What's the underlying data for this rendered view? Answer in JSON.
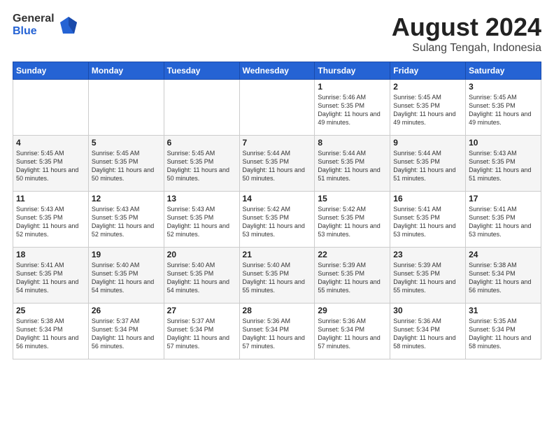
{
  "logo": {
    "general": "General",
    "blue": "Blue"
  },
  "title": {
    "month_year": "August 2024",
    "location": "Sulang Tengah, Indonesia"
  },
  "headers": [
    "Sunday",
    "Monday",
    "Tuesday",
    "Wednesday",
    "Thursday",
    "Friday",
    "Saturday"
  ],
  "weeks": [
    [
      {
        "day": "",
        "sunrise": "",
        "sunset": "",
        "daylight": ""
      },
      {
        "day": "",
        "sunrise": "",
        "sunset": "",
        "daylight": ""
      },
      {
        "day": "",
        "sunrise": "",
        "sunset": "",
        "daylight": ""
      },
      {
        "day": "",
        "sunrise": "",
        "sunset": "",
        "daylight": ""
      },
      {
        "day": "1",
        "sunrise": "Sunrise: 5:46 AM",
        "sunset": "Sunset: 5:35 PM",
        "daylight": "Daylight: 11 hours and 49 minutes."
      },
      {
        "day": "2",
        "sunrise": "Sunrise: 5:45 AM",
        "sunset": "Sunset: 5:35 PM",
        "daylight": "Daylight: 11 hours and 49 minutes."
      },
      {
        "day": "3",
        "sunrise": "Sunrise: 5:45 AM",
        "sunset": "Sunset: 5:35 PM",
        "daylight": "Daylight: 11 hours and 49 minutes."
      }
    ],
    [
      {
        "day": "4",
        "sunrise": "Sunrise: 5:45 AM",
        "sunset": "Sunset: 5:35 PM",
        "daylight": "Daylight: 11 hours and 50 minutes."
      },
      {
        "day": "5",
        "sunrise": "Sunrise: 5:45 AM",
        "sunset": "Sunset: 5:35 PM",
        "daylight": "Daylight: 11 hours and 50 minutes."
      },
      {
        "day": "6",
        "sunrise": "Sunrise: 5:45 AM",
        "sunset": "Sunset: 5:35 PM",
        "daylight": "Daylight: 11 hours and 50 minutes."
      },
      {
        "day": "7",
        "sunrise": "Sunrise: 5:44 AM",
        "sunset": "Sunset: 5:35 PM",
        "daylight": "Daylight: 11 hours and 50 minutes."
      },
      {
        "day": "8",
        "sunrise": "Sunrise: 5:44 AM",
        "sunset": "Sunset: 5:35 PM",
        "daylight": "Daylight: 11 hours and 51 minutes."
      },
      {
        "day": "9",
        "sunrise": "Sunrise: 5:44 AM",
        "sunset": "Sunset: 5:35 PM",
        "daylight": "Daylight: 11 hours and 51 minutes."
      },
      {
        "day": "10",
        "sunrise": "Sunrise: 5:43 AM",
        "sunset": "Sunset: 5:35 PM",
        "daylight": "Daylight: 11 hours and 51 minutes."
      }
    ],
    [
      {
        "day": "11",
        "sunrise": "Sunrise: 5:43 AM",
        "sunset": "Sunset: 5:35 PM",
        "daylight": "Daylight: 11 hours and 52 minutes."
      },
      {
        "day": "12",
        "sunrise": "Sunrise: 5:43 AM",
        "sunset": "Sunset: 5:35 PM",
        "daylight": "Daylight: 11 hours and 52 minutes."
      },
      {
        "day": "13",
        "sunrise": "Sunrise: 5:43 AM",
        "sunset": "Sunset: 5:35 PM",
        "daylight": "Daylight: 11 hours and 52 minutes."
      },
      {
        "day": "14",
        "sunrise": "Sunrise: 5:42 AM",
        "sunset": "Sunset: 5:35 PM",
        "daylight": "Daylight: 11 hours and 53 minutes."
      },
      {
        "day": "15",
        "sunrise": "Sunrise: 5:42 AM",
        "sunset": "Sunset: 5:35 PM",
        "daylight": "Daylight: 11 hours and 53 minutes."
      },
      {
        "day": "16",
        "sunrise": "Sunrise: 5:41 AM",
        "sunset": "Sunset: 5:35 PM",
        "daylight": "Daylight: 11 hours and 53 minutes."
      },
      {
        "day": "17",
        "sunrise": "Sunrise: 5:41 AM",
        "sunset": "Sunset: 5:35 PM",
        "daylight": "Daylight: 11 hours and 53 minutes."
      }
    ],
    [
      {
        "day": "18",
        "sunrise": "Sunrise: 5:41 AM",
        "sunset": "Sunset: 5:35 PM",
        "daylight": "Daylight: 11 hours and 54 minutes."
      },
      {
        "day": "19",
        "sunrise": "Sunrise: 5:40 AM",
        "sunset": "Sunset: 5:35 PM",
        "daylight": "Daylight: 11 hours and 54 minutes."
      },
      {
        "day": "20",
        "sunrise": "Sunrise: 5:40 AM",
        "sunset": "Sunset: 5:35 PM",
        "daylight": "Daylight: 11 hours and 54 minutes."
      },
      {
        "day": "21",
        "sunrise": "Sunrise: 5:40 AM",
        "sunset": "Sunset: 5:35 PM",
        "daylight": "Daylight: 11 hours and 55 minutes."
      },
      {
        "day": "22",
        "sunrise": "Sunrise: 5:39 AM",
        "sunset": "Sunset: 5:35 PM",
        "daylight": "Daylight: 11 hours and 55 minutes."
      },
      {
        "day": "23",
        "sunrise": "Sunrise: 5:39 AM",
        "sunset": "Sunset: 5:35 PM",
        "daylight": "Daylight: 11 hours and 55 minutes."
      },
      {
        "day": "24",
        "sunrise": "Sunrise: 5:38 AM",
        "sunset": "Sunset: 5:34 PM",
        "daylight": "Daylight: 11 hours and 56 minutes."
      }
    ],
    [
      {
        "day": "25",
        "sunrise": "Sunrise: 5:38 AM",
        "sunset": "Sunset: 5:34 PM",
        "daylight": "Daylight: 11 hours and 56 minutes."
      },
      {
        "day": "26",
        "sunrise": "Sunrise: 5:37 AM",
        "sunset": "Sunset: 5:34 PM",
        "daylight": "Daylight: 11 hours and 56 minutes."
      },
      {
        "day": "27",
        "sunrise": "Sunrise: 5:37 AM",
        "sunset": "Sunset: 5:34 PM",
        "daylight": "Daylight: 11 hours and 57 minutes."
      },
      {
        "day": "28",
        "sunrise": "Sunrise: 5:36 AM",
        "sunset": "Sunset: 5:34 PM",
        "daylight": "Daylight: 11 hours and 57 minutes."
      },
      {
        "day": "29",
        "sunrise": "Sunrise: 5:36 AM",
        "sunset": "Sunset: 5:34 PM",
        "daylight": "Daylight: 11 hours and 57 minutes."
      },
      {
        "day": "30",
        "sunrise": "Sunrise: 5:36 AM",
        "sunset": "Sunset: 5:34 PM",
        "daylight": "Daylight: 11 hours and 58 minutes."
      },
      {
        "day": "31",
        "sunrise": "Sunrise: 5:35 AM",
        "sunset": "Sunset: 5:34 PM",
        "daylight": "Daylight: 11 hours and 58 minutes."
      }
    ]
  ]
}
